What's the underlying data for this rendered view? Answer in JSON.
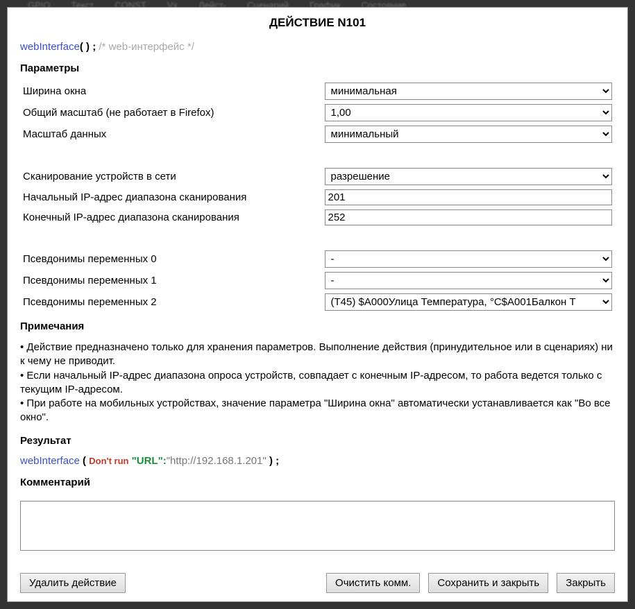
{
  "bg_tabs": [
    "GPIO",
    "Текст",
    "CONST",
    "Vx",
    "Дейст-",
    "Сценарий",
    "График",
    "Состояние"
  ],
  "dialog": {
    "title": "ДЕЙСТВИЕ N101",
    "code": {
      "fn": "webInterface",
      "args": "( ) ;",
      "comment": "/* web-интерфейс */"
    }
  },
  "sections": {
    "params_title": "Параметры",
    "notes_title": "Примечания",
    "result_title": "Результат",
    "comment_title": "Комментарий"
  },
  "params": {
    "window_width": {
      "label": "Ширина окна",
      "value": "минимальная"
    },
    "global_scale": {
      "label": "Общий масштаб (не работает в Firefox)",
      "value": "1,00"
    },
    "data_scale": {
      "label": "Масштаб данных",
      "value": "минимальный"
    },
    "scan_devices": {
      "label": "Сканирование устройств в сети",
      "value": "разрешение"
    },
    "ip_start": {
      "label": "Начальный IP-адрес диапазона сканирования",
      "value": "201"
    },
    "ip_end": {
      "label": "Конечный IP-адрес диапазона сканирования",
      "value": "252"
    },
    "alias0": {
      "label": "Псевдонимы переменных 0",
      "value": "-"
    },
    "alias1": {
      "label": "Псевдонимы переменных 1",
      "value": "-"
    },
    "alias2": {
      "label": "Псевдонимы переменных 2",
      "value": "(T45)  $A000Улица Температура, °C$A001Балкон Т"
    }
  },
  "notes": {
    "line1": "• Действие предназначено только для хранения параметров. Выполнение действия (принудительное или в сценариях) ни к чему не приводит.",
    "line2": "• Если начальный IP-адрес диапазона опроса устройств, совпадает с конечным IP-адресом, то работа ведется только с текущим IP-адресом.",
    "line3": "• При работе на мобильных устройствах, значение параметра \"Ширина окна\" автоматически устанавливается как \"Во все окно\"."
  },
  "result": {
    "fn": "webInterface",
    "open": " ( ",
    "dontrun": "Don't run",
    "key": " \"URL\":",
    "val": "\"http://192.168.1.201\"",
    "close": " ) ;"
  },
  "comment_value": "",
  "buttons": {
    "delete": "Удалить действие",
    "clear": "Очистить комм.",
    "save": "Сохранить и закрыть",
    "close": "Закрыть"
  }
}
